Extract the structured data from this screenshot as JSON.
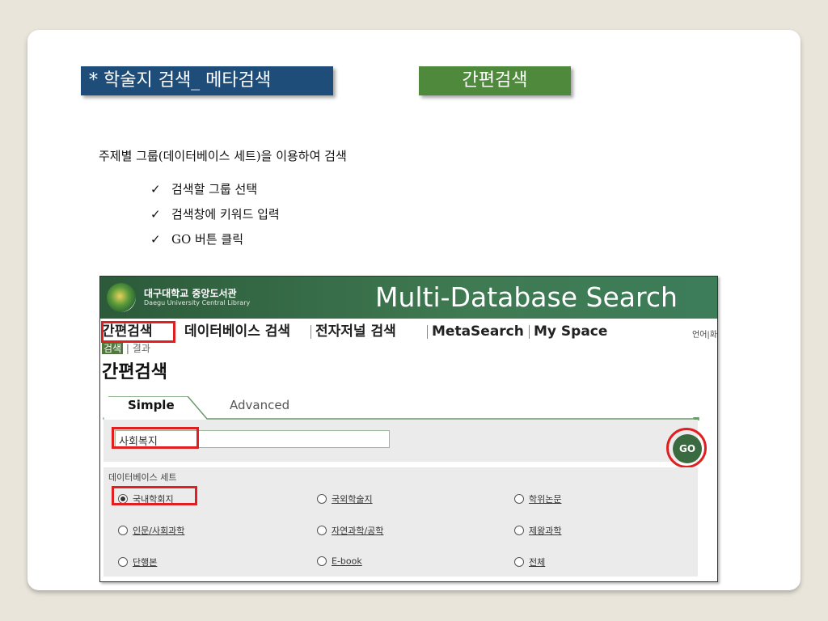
{
  "slide": {
    "title": "* 학술지 검색_ 메타검색",
    "tag": "간편검색",
    "description": "주제별 그룹(데이터베이스 세트)을 이용하여 검색",
    "steps": [
      "검색할 그룹 선택",
      "검색창에 키워드 입력",
      "GO 버튼 클릭"
    ],
    "check_glyph": "✓"
  },
  "app": {
    "library_name_ko": "대구대학교 중앙도서관",
    "library_name_en": "Daegu University Central Library",
    "banner_title": "Multi-Database Search",
    "nav": [
      "간편검색",
      "데이터베이스 검색",
      "전자저널 검색",
      "MetaSearch",
      "My Space"
    ],
    "lang_link": "언어|화",
    "sub_links": {
      "current": "검색",
      "other": "결과",
      "sep": "|"
    },
    "page_heading": "간편검색",
    "tabs": [
      "Simple",
      "Advanced"
    ],
    "search_value": "사회복지",
    "go_label": "GO",
    "db_set_title": "데이터베이스 세트",
    "db_options": [
      [
        "국내학회지",
        "국외학술지",
        "학위논문"
      ],
      [
        "인문/사회과학",
        "자연과학/공학",
        "제왕과학"
      ],
      [
        "단행본",
        "E-book",
        "전체"
      ]
    ],
    "selected_option": "국내학회지",
    "colors": {
      "title_box": "#1f4d79",
      "tag_box": "#4f8a3c",
      "banner": "#3f7a52",
      "highlight": "#e02020"
    }
  }
}
